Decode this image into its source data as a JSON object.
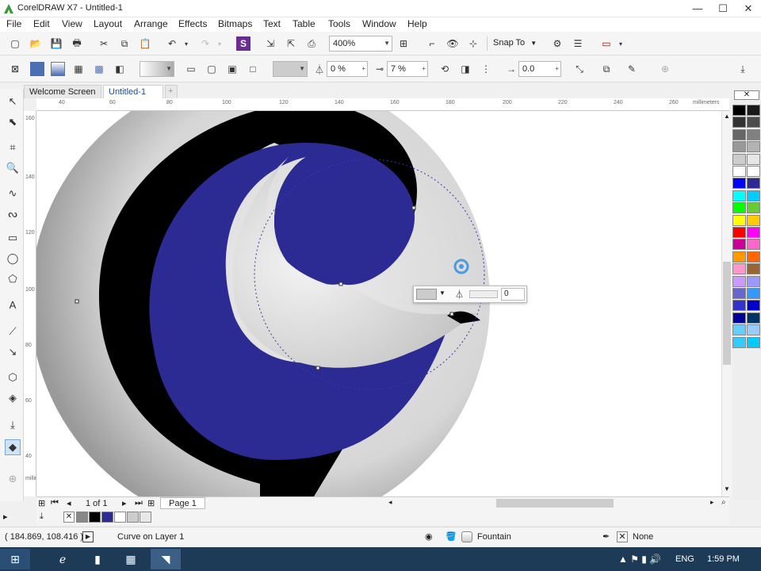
{
  "app": {
    "title": "CorelDRAW X7 - Untitled-1"
  },
  "window_controls": {
    "minimize": "—",
    "maximize": "☐",
    "close": "✕"
  },
  "menu": [
    "File",
    "Edit",
    "View",
    "Layout",
    "Arrange",
    "Effects",
    "Bitmaps",
    "Text",
    "Table",
    "Tools",
    "Window",
    "Help"
  ],
  "toolbar1": {
    "zoom_value": "400%",
    "snap_to_label": "Snap To"
  },
  "toolbar2": {
    "transparency_value": "0 %",
    "feather_value": "7 %",
    "offset_value": "0.0"
  },
  "tabs": [
    {
      "label": "Welcome Screen"
    },
    {
      "label": "Untitled-1"
    }
  ],
  "ruler": {
    "h_ticks": [
      "40",
      "60",
      "80",
      "100",
      "120",
      "140",
      "160",
      "180",
      "200",
      "220",
      "240",
      "260"
    ],
    "h_unit": "millimeters",
    "v_ticks": [
      "160",
      "140",
      "120",
      "100",
      "80",
      "60",
      "40"
    ],
    "v_unit": "millimeters"
  },
  "float_toolbar": {
    "value": "0"
  },
  "page_nav": {
    "counter": "1 of 1",
    "page_tab": "Page 1"
  },
  "status": {
    "coords": "( 184.869, 108.416 )",
    "object_info": "Curve on Layer 1",
    "fill_label": "Fountain",
    "outline_label": "None"
  },
  "taskbar": {
    "lang": "ENG",
    "time": "1:59 PM"
  },
  "colors": {
    "swirl_blue": "#2c2a93",
    "swirl_black": "#000000",
    "sphere_gray": "#c9c9c9",
    "palette": [
      "#000000",
      "#1a1a1a",
      "#333333",
      "#4d4d4d",
      "#666666",
      "#808080",
      "#999999",
      "#b3b3b3",
      "#cccccc",
      "#e6e6e6",
      "#ffffff",
      "#ffffff",
      "#0000ff",
      "#2c2a93",
      "#00ffff",
      "#00ccff",
      "#00ff00",
      "#66cc33",
      "#ffff00",
      "#ffcc00",
      "#ff0000",
      "#ff00ff",
      "#cc0099",
      "#ff66cc",
      "#ff9900",
      "#ff6600",
      "#ff99cc",
      "#996633",
      "#cc99ff",
      "#9999ff",
      "#6666cc",
      "#3399ff",
      "#3333cc",
      "#0000cc",
      "#000099",
      "#003366",
      "#66ccff",
      "#99ccff",
      "#33ccff",
      "#00ccff"
    ],
    "doc_palette": [
      "#888888",
      "#000000",
      "#2c2a93",
      "#ffffff",
      "#cccccc",
      "#e8e8e8"
    ]
  }
}
